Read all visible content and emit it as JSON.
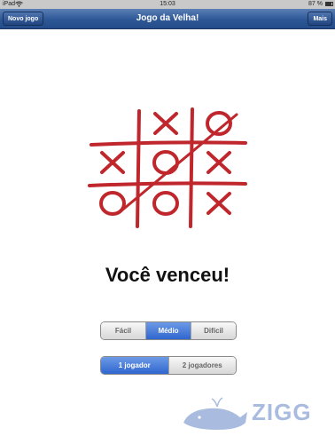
{
  "status_bar": {
    "carrier": "iPad",
    "time": "15:03",
    "battery": "87 %",
    "battery_level": 0.87
  },
  "nav": {
    "left_button": "Novo jogo",
    "title": "Jogo da Velha!",
    "right_button": "Mais"
  },
  "board": {
    "cells": [
      "",
      "X",
      "O",
      "X",
      "O",
      "X",
      "O",
      "O",
      "X"
    ],
    "winning_line": "diagonal"
  },
  "result_text": "Você venceu!",
  "difficulty": {
    "options": [
      "Fácil",
      "Médio",
      "Difícil"
    ],
    "selected": "Médio"
  },
  "players": {
    "options": [
      "1 jogador",
      "2 jogadores"
    ],
    "selected": "1 jogador"
  },
  "watermark": {
    "text": "ZIGG"
  },
  "colors": {
    "nav": "#2d5796",
    "board_ink": "#c0272d",
    "segment_active": "#3a72d8"
  }
}
